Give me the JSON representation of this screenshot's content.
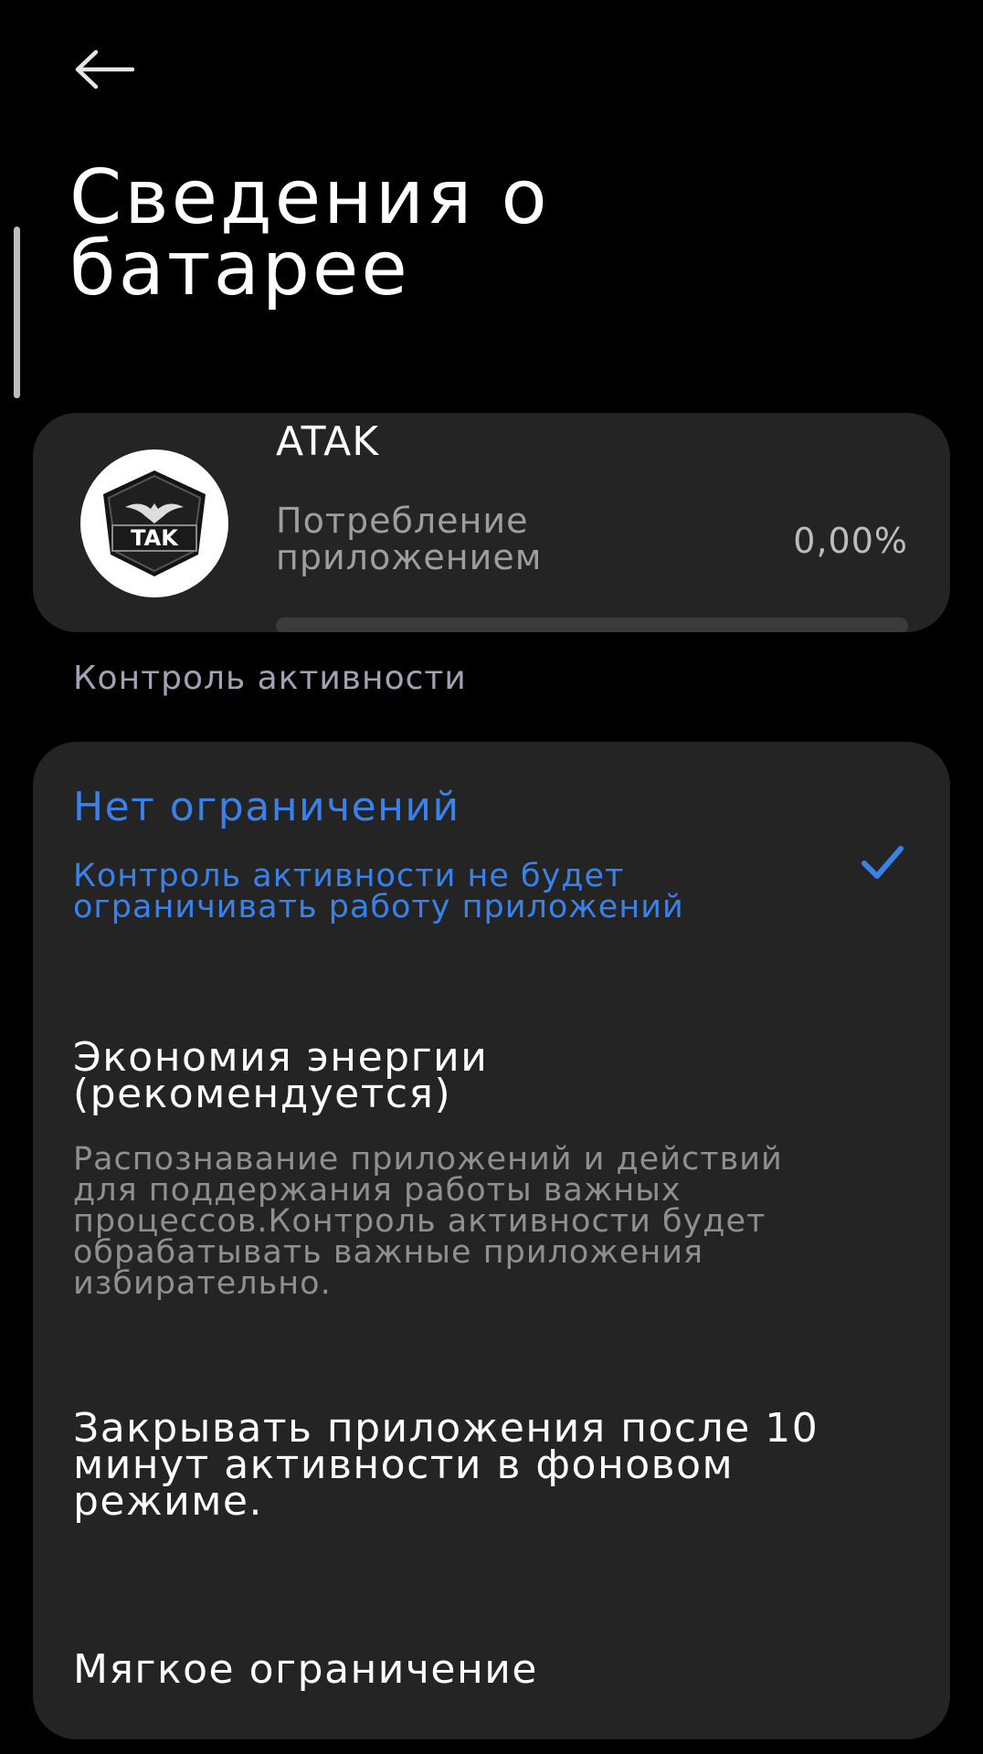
{
  "header": {
    "title": "Сведения о батарее"
  },
  "app": {
    "name": "ATAK",
    "icon_text": "TAK",
    "usage_label": "Потребление приложением",
    "usage_value": "0,00%",
    "usage_fraction": 0.0
  },
  "activity_control": {
    "section_title": "Контроль активности",
    "options": [
      {
        "title": "Нет ограничений",
        "description": "Контроль активности не будет ограничивать работу приложений",
        "selected": true
      },
      {
        "title": "Экономия энергии (рекомендуется)",
        "description": "Распознавание приложений и действий для поддержания работы важных процессов.Контроль активности будет обрабатывать важные приложения избирательно.",
        "selected": false
      },
      {
        "title": "Закрывать приложения после 10 минут активности в фоновом режиме.",
        "description": "",
        "selected": false
      },
      {
        "title": "Мягкое ограничение",
        "description": "",
        "selected": false
      }
    ]
  },
  "colors": {
    "background": "#000000",
    "card": "#242424",
    "accent": "#3a82ea",
    "secondary_text": "#8f8f8f"
  },
  "icons": {
    "back": "arrow-left-icon",
    "check": "check-icon",
    "app": "atak-app-icon"
  }
}
